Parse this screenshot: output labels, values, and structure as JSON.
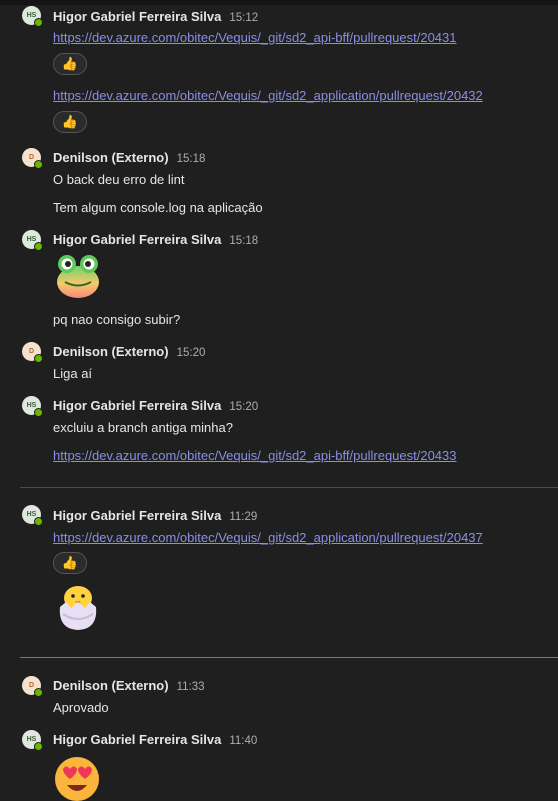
{
  "messages": [
    {
      "avatar": "HS",
      "author": "Higor Gabriel Ferreira Silva",
      "time": "15:12",
      "link1": "https://dev.azure.com/obitec/Vequis/_git/sd2_api-bff/pullrequest/20431",
      "link2": "https://dev.azure.com/obitec/Vequis/_git/sd2_application/pullrequest/20432"
    },
    {
      "avatar": "D",
      "author": "Denilson (Externo)",
      "time": "15:18",
      "text1": "O back deu erro de lint",
      "text2": "Tem algum console.log na aplicação"
    },
    {
      "avatar": "HS",
      "author": "Higor Gabriel Ferreira Silva",
      "time": "15:18",
      "sticker": "frog-emoji",
      "text": "pq nao consigo subir?"
    },
    {
      "avatar": "D",
      "author": "Denilson (Externo)",
      "time": "15:20",
      "text": "Liga aí"
    },
    {
      "avatar": "HS",
      "author": "Higor Gabriel Ferreira Silva",
      "time": "15:20",
      "text": "excluiu a branch antiga minha?",
      "link": "https://dev.azure.com/obitec/Vequis/_git/sd2_api-bff/pullrequest/20433"
    },
    {
      "avatar": "HS",
      "author": "Higor Gabriel Ferreira Silva",
      "time": "11:29",
      "link": "https://dev.azure.com/obitec/Vequis/_git/sd2_application/pullrequest/20437",
      "sticker": "hatching-chick-emoji"
    },
    {
      "avatar": "D",
      "author": "Denilson (Externo)",
      "time": "11:33",
      "text": "Aprovado"
    },
    {
      "avatar": "HS",
      "author": "Higor Gabriel Ferreira Silva",
      "time": "11:40",
      "sticker": "heart-eyes-emoji"
    }
  ],
  "reaction_icon": "thumbs-up-icon",
  "colors": {
    "background": "#1f1f1f",
    "link": "#8a8ee8",
    "presence": "#6bb700",
    "new_divider": "#6a6fd1"
  }
}
